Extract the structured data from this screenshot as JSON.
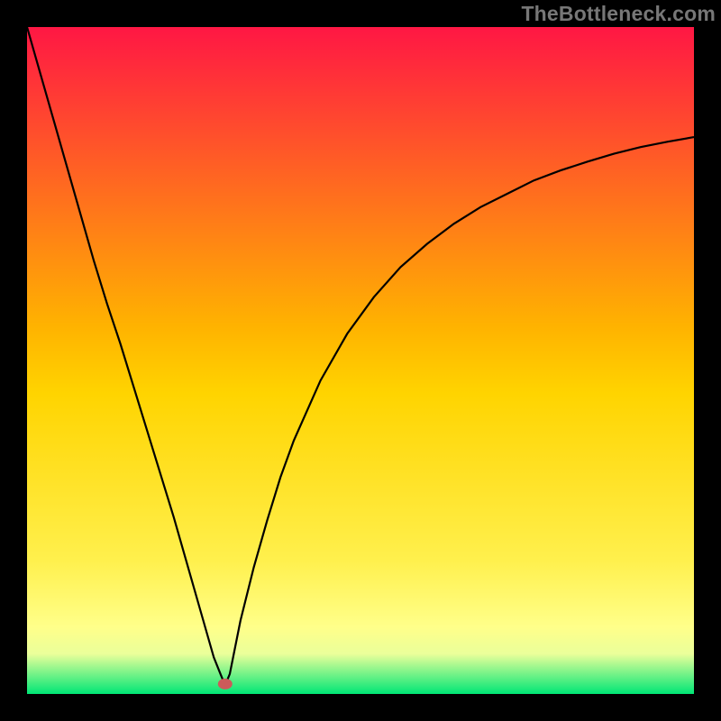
{
  "watermark": "TheBottleneck.com",
  "chart_data": {
    "type": "line",
    "title": "",
    "xlabel": "",
    "ylabel": "",
    "xlim": [
      0,
      100
    ],
    "ylim": [
      0,
      100
    ],
    "grid": false,
    "legend": false,
    "background_gradient": {
      "top_color": "#ff1744",
      "mid_color": "#ffd400",
      "bottom_color": "#00e676"
    },
    "minimum_marker": {
      "x": 29.7,
      "y": 1.5,
      "color": "#cc5a5a"
    },
    "series": [
      {
        "name": "curve",
        "color": "#000000",
        "x": [
          0,
          2,
          4,
          6,
          8,
          10,
          12,
          14,
          16,
          18,
          20,
          22,
          24,
          26,
          28,
          29,
          29.7,
          30.4,
          31,
          32,
          34,
          36,
          38,
          40,
          44,
          48,
          52,
          56,
          60,
          64,
          68,
          72,
          76,
          80,
          84,
          88,
          92,
          96,
          100
        ],
        "values": [
          100,
          93,
          86,
          79,
          72,
          65,
          58.5,
          52.5,
          46,
          39.5,
          33,
          26.5,
          19.5,
          12.5,
          5.5,
          3,
          1.3,
          3,
          6,
          11,
          19,
          26,
          32.5,
          38,
          47,
          54,
          59.5,
          64,
          67.5,
          70.5,
          73,
          75,
          77,
          78.5,
          79.8,
          81,
          82,
          82.8,
          83.5
        ]
      }
    ]
  }
}
